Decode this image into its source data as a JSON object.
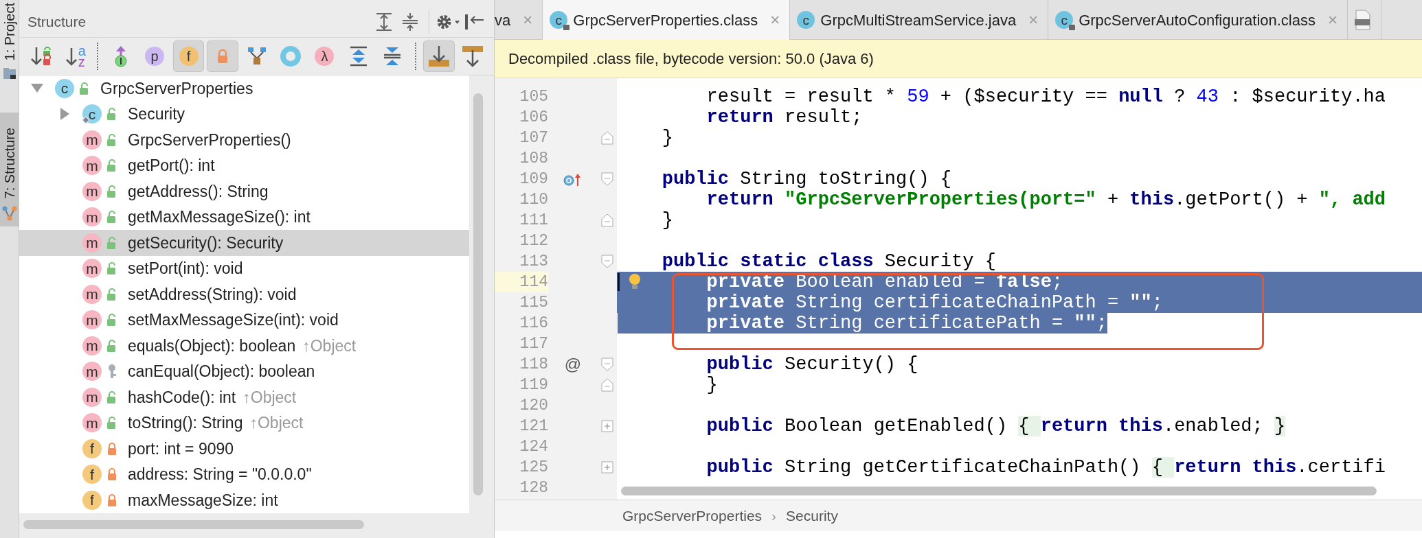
{
  "side_tabs": [
    {
      "label": "1: Project",
      "kind": "project",
      "selected": false
    },
    {
      "label": "7: Structure",
      "kind": "structure",
      "selected": true
    }
  ],
  "structure": {
    "title": "Structure",
    "header_tools": [
      {
        "kind": "expand-all"
      },
      {
        "kind": "collapse-all"
      },
      {
        "kind": "settings"
      },
      {
        "kind": "hide"
      }
    ],
    "toolbar": [
      {
        "kind": "sort-visibility",
        "pressed": false
      },
      {
        "kind": "sort-alpha",
        "glyphs": [
          "a",
          "z"
        ],
        "pressed": false
      },
      {
        "kind": "separator"
      },
      {
        "kind": "inherited",
        "pressed": false
      },
      {
        "kind": "letter",
        "text": "p",
        "color": "#cbb8f2",
        "pressed": false
      },
      {
        "kind": "letter",
        "text": "f",
        "color": "#f2c072",
        "pressed": true
      },
      {
        "kind": "lock",
        "pressed": true
      },
      {
        "kind": "hierarchy",
        "pressed": false
      },
      {
        "kind": "ring",
        "pressed": false
      },
      {
        "kind": "letter",
        "text": "λ",
        "color": "#f6b0bd",
        "pressed": false
      },
      {
        "kind": "expand",
        "pressed": false
      },
      {
        "kind": "collapse",
        "pressed": false
      },
      {
        "kind": "separator"
      },
      {
        "kind": "scroll-to",
        "pressed": true
      },
      {
        "kind": "scroll-from",
        "pressed": false
      }
    ],
    "tree": [
      {
        "kind": "class",
        "badge": "c",
        "access": {
          "kind": "public"
        },
        "static": false,
        "label": "GrpcServerProperties",
        "expanded": true,
        "selected": false,
        "children": [
          {
            "kind": "class",
            "badge": "c",
            "access": {
              "kind": "public"
            },
            "static": true,
            "label": "Security",
            "expanded": false,
            "selected": false
          },
          {
            "kind": "method",
            "badge": "m",
            "access": {
              "kind": "public"
            },
            "static": false,
            "label": "GrpcServerProperties()",
            "selected": false
          },
          {
            "kind": "method",
            "badge": "m",
            "access": {
              "kind": "public"
            },
            "static": false,
            "label": "getPort(): int",
            "selected": false
          },
          {
            "kind": "method",
            "badge": "m",
            "access": {
              "kind": "public"
            },
            "static": false,
            "label": "getAddress(): String",
            "selected": false
          },
          {
            "kind": "method",
            "badge": "m",
            "access": {
              "kind": "public"
            },
            "static": false,
            "label": "getMaxMessageSize(): int",
            "selected": false
          },
          {
            "kind": "method",
            "badge": "m",
            "access": {
              "kind": "public"
            },
            "static": false,
            "label": "getSecurity(): Security",
            "selected": true
          },
          {
            "kind": "method",
            "badge": "m",
            "access": {
              "kind": "public"
            },
            "static": false,
            "label": "setPort(int): void",
            "selected": false
          },
          {
            "kind": "method",
            "badge": "m",
            "access": {
              "kind": "public"
            },
            "static": false,
            "label": "setAddress(String): void",
            "selected": false
          },
          {
            "kind": "method",
            "badge": "m",
            "access": {
              "kind": "public"
            },
            "static": false,
            "label": "setMaxMessageSize(int): void",
            "selected": false
          },
          {
            "kind": "method",
            "badge": "m",
            "access": {
              "kind": "public"
            },
            "static": false,
            "label": "equals(Object): boolean",
            "origin": "↑Object",
            "selected": false
          },
          {
            "kind": "method",
            "badge": "m",
            "access": {
              "kind": "protected"
            },
            "static": false,
            "label": "canEqual(Object): boolean",
            "selected": false
          },
          {
            "kind": "method",
            "badge": "m",
            "access": {
              "kind": "public"
            },
            "static": false,
            "label": "hashCode(): int",
            "origin": "↑Object",
            "selected": false
          },
          {
            "kind": "method",
            "badge": "m",
            "access": {
              "kind": "public"
            },
            "static": false,
            "label": "toString(): String",
            "origin": "↑Object",
            "selected": false
          },
          {
            "kind": "field",
            "badge": "f",
            "access": {
              "kind": "private"
            },
            "static": false,
            "label": "port: int = 9090",
            "selected": false
          },
          {
            "kind": "field",
            "badge": "f",
            "access": {
              "kind": "private"
            },
            "static": false,
            "label": "address: String = \"0.0.0.0\"",
            "selected": false
          },
          {
            "kind": "field",
            "badge": "f",
            "access": {
              "kind": "private"
            },
            "static": false,
            "label": "maxMessageSize: int",
            "selected": false
          }
        ]
      }
    ]
  },
  "editor": {
    "tabs": [
      {
        "kind": "partial",
        "label": "va",
        "close": "×",
        "selected": false
      },
      {
        "kind": "class-locked",
        "label": "GrpcServerProperties.class",
        "close": "×",
        "icon_letter": "c",
        "selected": true
      },
      {
        "kind": "class",
        "label": "GrpcMultiStreamService.java",
        "close": "×",
        "icon_letter": "c",
        "selected": false
      },
      {
        "kind": "class-locked",
        "label": "GrpcServerAutoConfiguration.class",
        "close": "×",
        "icon_letter": "c",
        "selected": false
      },
      {
        "kind": "json",
        "selected": false
      }
    ],
    "banner": "Decompiled .class file, bytecode version: 50.0 (Java 6)",
    "lines": [
      {
        "number": "105",
        "current": false,
        "selected": false,
        "tokens": [
          {
            "kind": "plain",
            "text": "        result = result * "
          },
          {
            "kind": "num",
            "text": "59"
          },
          {
            "kind": "plain",
            "text": " + ($security == "
          },
          {
            "kind": "kw",
            "text": "null"
          },
          {
            "kind": "plain",
            "text": " ? "
          },
          {
            "kind": "num",
            "text": "43"
          },
          {
            "kind": "plain",
            "text": " : $security.ha"
          }
        ]
      },
      {
        "number": "106",
        "current": false,
        "selected": false,
        "tokens": [
          {
            "kind": "kw",
            "text": "        return"
          },
          {
            "kind": "plain",
            "text": " result;"
          }
        ]
      },
      {
        "number": "107",
        "current": false,
        "selected": false,
        "fold": {
          "kind": "end"
        },
        "tokens": [
          {
            "kind": "plain",
            "text": "    }"
          }
        ]
      },
      {
        "number": "108",
        "current": false,
        "selected": false
      },
      {
        "number": "109",
        "current": false,
        "selected": false,
        "marker": {
          "kind": "override"
        },
        "fold": {
          "kind": "start"
        },
        "tokens": [
          {
            "kind": "kw",
            "text": "    public"
          },
          {
            "kind": "plain",
            "text": " String toString() {"
          }
        ]
      },
      {
        "number": "110",
        "current": false,
        "selected": false,
        "tokens": [
          {
            "kind": "kw",
            "text": "        return"
          },
          {
            "kind": "str",
            "text": " \"GrpcServerProperties(port=\""
          },
          {
            "kind": "plain",
            "text": " + "
          },
          {
            "kind": "kw",
            "text": "this"
          },
          {
            "kind": "plain",
            "text": ".getPort() + "
          },
          {
            "kind": "str",
            "text": "\", add"
          }
        ]
      },
      {
        "number": "111",
        "current": false,
        "selected": false,
        "fold": {
          "kind": "end"
        },
        "tokens": [
          {
            "kind": "plain",
            "text": "    }"
          }
        ]
      },
      {
        "number": "112",
        "current": false,
        "selected": false
      },
      {
        "number": "113",
        "current": false,
        "selected": false,
        "fold": {
          "kind": "start"
        },
        "tokens": [
          {
            "kind": "kw",
            "text": "    public"
          },
          {
            "kind": "kw",
            "text": " static"
          },
          {
            "kind": "kw",
            "text": " class"
          },
          {
            "kind": "plain",
            "text": " Security {"
          }
        ]
      },
      {
        "number": "114",
        "current": true,
        "selected": true,
        "selection": {
          "kind": "line"
        },
        "marker": {
          "kind": "bulb"
        },
        "tokens": [
          {
            "kind": "kw",
            "text": "        private"
          },
          {
            "kind": "plain",
            "text": " Boolean enabled = "
          },
          {
            "kind": "kw",
            "text": "false"
          },
          {
            "kind": "plain",
            "text": ";"
          }
        ]
      },
      {
        "number": "115",
        "current": false,
        "selected": true,
        "selection": {
          "kind": "line"
        },
        "tokens": [
          {
            "kind": "kw",
            "text": "        private"
          },
          {
            "kind": "plain",
            "text": " String certificateChainPath = "
          },
          {
            "kind": "str",
            "text": "\"\""
          },
          {
            "kind": "plain",
            "text": ";"
          }
        ]
      },
      {
        "number": "116",
        "current": false,
        "selected": true,
        "selection": {
          "kind": "text"
        },
        "tokens": [
          {
            "kind": "kw",
            "text": "        private"
          },
          {
            "kind": "plain",
            "text": " String certificatePath = "
          },
          {
            "kind": "str",
            "text": "\"\""
          },
          {
            "kind": "plain",
            "text": ";"
          }
        ]
      },
      {
        "number": "117",
        "current": false,
        "selected": false
      },
      {
        "number": "118",
        "current": false,
        "selected": false,
        "marker": {
          "kind": "text",
          "text": "@"
        },
        "fold": {
          "kind": "start"
        },
        "tokens": [
          {
            "kind": "kw",
            "text": "        public"
          },
          {
            "kind": "plain",
            "text": " Security() {"
          }
        ]
      },
      {
        "number": "119",
        "current": false,
        "selected": false,
        "fold": {
          "kind": "end"
        },
        "tokens": [
          {
            "kind": "plain",
            "text": "        }"
          }
        ]
      },
      {
        "number": "120",
        "current": false,
        "selected": false
      },
      {
        "number": "121",
        "current": false,
        "selected": false,
        "fold": {
          "kind": "collapsed"
        },
        "tokens": [
          {
            "kind": "kw",
            "text": "        public"
          },
          {
            "kind": "plain",
            "text": " Boolean getEnabled() "
          },
          {
            "kind": "fold",
            "text": "{ "
          },
          {
            "kind": "kw",
            "text": "return"
          },
          {
            "kind": "kw",
            "text": " this"
          },
          {
            "kind": "plain",
            "text": ".enabled; "
          },
          {
            "kind": "fold",
            "text": "}"
          }
        ]
      },
      {
        "number": "124",
        "current": false,
        "selected": false
      },
      {
        "number": "125",
        "current": false,
        "selected": false,
        "fold": {
          "kind": "collapsed"
        },
        "tokens": [
          {
            "kind": "kw",
            "text": "        public"
          },
          {
            "kind": "plain",
            "text": " String getCertificateChainPath() "
          },
          {
            "kind": "fold",
            "text": "{ "
          },
          {
            "kind": "kw",
            "text": "return"
          },
          {
            "kind": "kw",
            "text": " this"
          },
          {
            "kind": "plain",
            "text": ".certifi"
          }
        ]
      },
      {
        "number": "128",
        "current": false,
        "selected": false
      }
    ],
    "callout": {
      "kind": "rounded-rect"
    },
    "breadcrumb": {
      "items": [
        "GrpcServerProperties",
        "Security"
      ],
      "separator": "›"
    }
  }
}
